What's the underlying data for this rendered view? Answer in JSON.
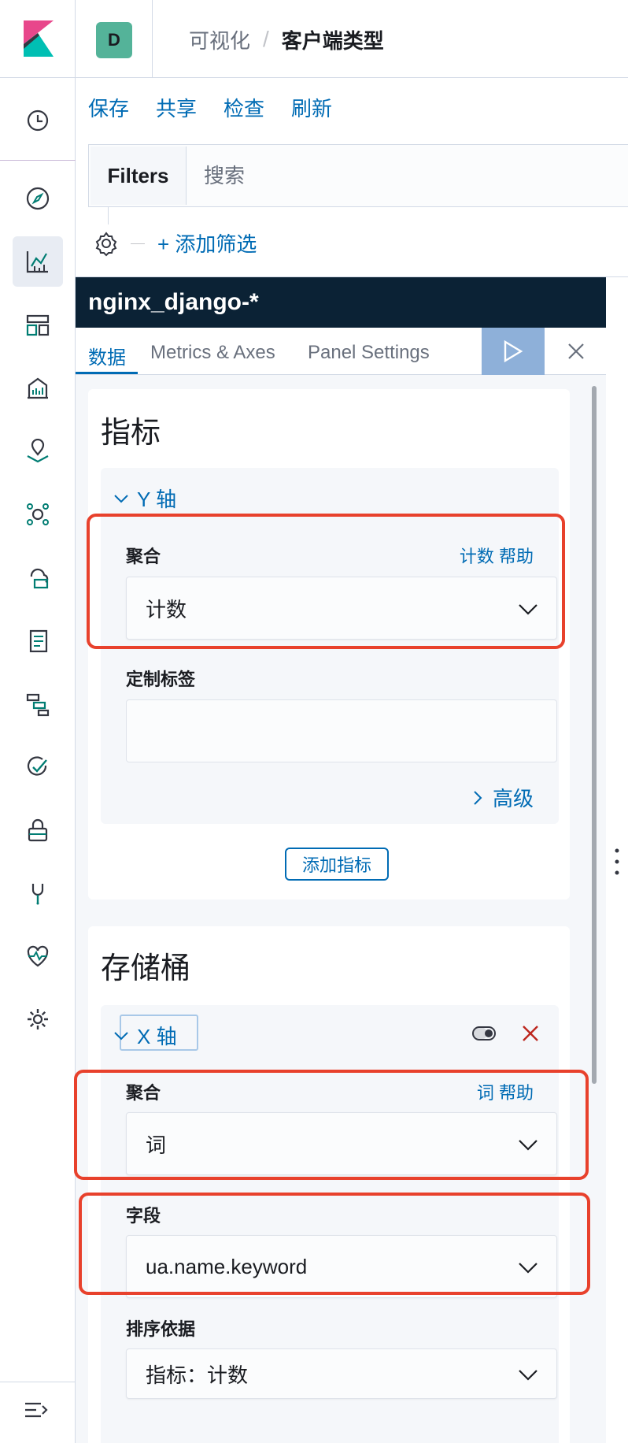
{
  "header": {
    "space_initial": "D",
    "breadcrumb_parent": "可视化",
    "breadcrumb_separator": "/",
    "breadcrumb_current": "客户端类型"
  },
  "nav": {
    "items": [
      "recent-icon",
      "discover-icon",
      "visualize-icon",
      "dashboard-icon",
      "canvas-icon",
      "maps-icon",
      "ml-icon",
      "infrastructure-icon",
      "logs-icon",
      "apm-icon",
      "uptime-icon",
      "security-icon",
      "dev-tools-icon",
      "monitoring-icon",
      "management-icon"
    ],
    "active_item": "visualize-icon",
    "collapse_icon": "collapse-menu-icon"
  },
  "actions": {
    "save": "保存",
    "share": "共享",
    "inspect": "检查",
    "refresh": "刷新"
  },
  "query": {
    "filters_label": "Filters",
    "search_placeholder": "搜索",
    "add_filter": "+ 添加筛选"
  },
  "editor": {
    "index_pattern": "nginx_django-*",
    "tabs": [
      "数据",
      "Metrics & Axes",
      "Panel Settings"
    ],
    "selected_tab": "数据",
    "metrics": {
      "title": "指标",
      "y_axis_label": "Y 轴",
      "agg_label": "聚合",
      "agg_help": "计数 帮助",
      "agg_value": "计数",
      "custom_label": "定制标签",
      "custom_label_value": "",
      "advanced": "高级",
      "add_metric": "添加指标"
    },
    "buckets": {
      "title": "存储桶",
      "x_axis_label": "X 轴",
      "agg_label": "聚合",
      "agg_help": "词 帮助",
      "agg_value": "词",
      "field_label": "字段",
      "field_value": "ua.name.keyword",
      "order_label": "排序依据",
      "order_value": "指标：计数"
    }
  },
  "colors": {
    "accent": "#006bb4",
    "header_dark": "#0b2235",
    "play_button": "#8eb0d9",
    "highlight": "#e8412c",
    "space_avatar": "#54b399",
    "remove": "#bd271e"
  }
}
